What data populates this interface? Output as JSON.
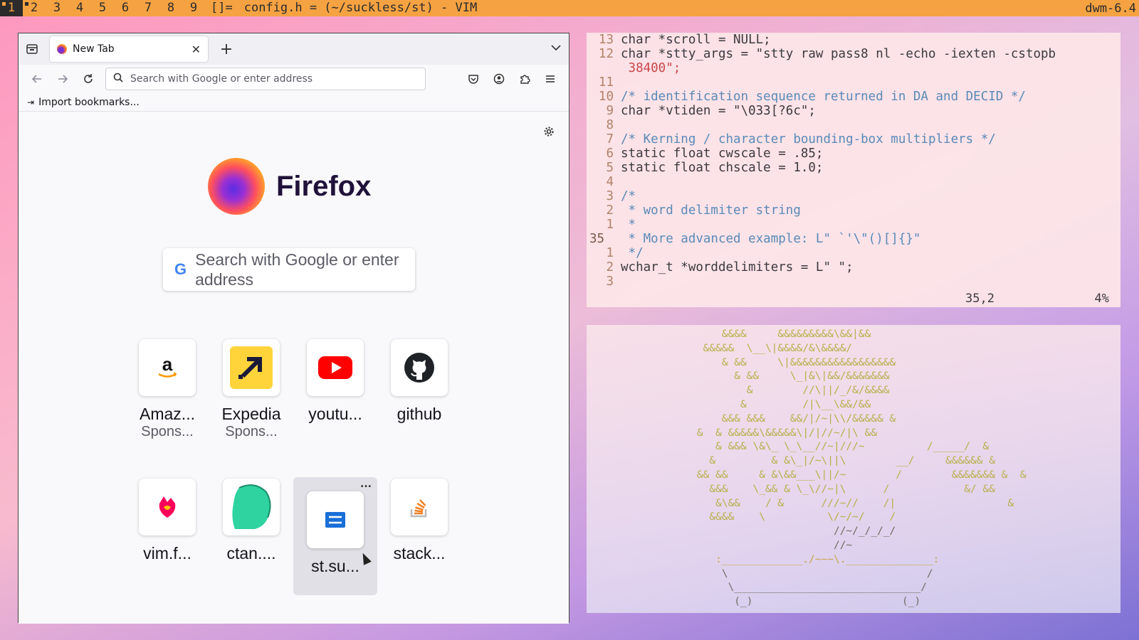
{
  "topbar": {
    "tags": [
      "1",
      "2",
      "3",
      "4",
      "5",
      "6",
      "7",
      "8",
      "9"
    ],
    "layout_symbol": "[]=",
    "window_title": "config.h = (~/suckless/st) - VIM",
    "status": "dwm-6.4"
  },
  "browser": {
    "tab_title": "New Tab",
    "tab_close": "✕",
    "new_tab": "+",
    "url_placeholder": "Search with Google or enter address",
    "import_bookmarks": "Import bookmarks...",
    "brand": "Firefox",
    "search_placeholder": "Search with Google or enter address",
    "shortcuts": [
      {
        "label": "Amaz...",
        "sub": "Spons...",
        "icon": "amazon-icon"
      },
      {
        "label": "Expedia",
        "sub": "Spons...",
        "icon": "expedia-icon"
      },
      {
        "label": "youtu...",
        "sub": "",
        "icon": "youtube-icon"
      },
      {
        "label": "github",
        "sub": "",
        "icon": "github-icon"
      },
      {
        "label": "vim.f...",
        "sub": "",
        "icon": "vim-fandom-icon"
      },
      {
        "label": "ctan....",
        "sub": "",
        "icon": "ctan-icon"
      },
      {
        "label": "st.su...",
        "sub": "",
        "icon": "st-suckless-icon"
      },
      {
        "label": "stack...",
        "sub": "",
        "icon": "stackoverflow-icon"
      }
    ],
    "tile_menu": "..."
  },
  "vim": {
    "lines": [
      {
        "n": "13",
        "text": "char *scroll = NULL;"
      },
      {
        "n": "12",
        "text": "char *stty_args = \"stty raw pass8 nl -echo -iexten -cstopb"
      },
      {
        "n": "",
        "text": " 38400\";"
      },
      {
        "n": "11",
        "text": ""
      },
      {
        "n": "10",
        "text": "/* identification sequence returned in DA and DECID */"
      },
      {
        "n": "9",
        "text": "char *vtiden = \"\\033[?6c\";"
      },
      {
        "n": "8",
        "text": ""
      },
      {
        "n": "7",
        "text": "/* Kerning / character bounding-box multipliers */"
      },
      {
        "n": "6",
        "text": "static float cwscale = .85;"
      },
      {
        "n": "5",
        "text": "static float chscale = 1.0;"
      },
      {
        "n": "4",
        "text": ""
      },
      {
        "n": "3",
        "text": "/*"
      },
      {
        "n": "2",
        "text": " * word delimiter string"
      },
      {
        "n": "1",
        "text": " *"
      },
      {
        "n": "35",
        "text": " * More advanced example: L\" `'\\\"()[]{}\""
      },
      {
        "n": "1",
        "text": " */"
      },
      {
        "n": "2",
        "text": "wchar_t *worddelimiters = L\" \";"
      },
      {
        "n": "3",
        "text": ""
      }
    ],
    "status_pos": "35,2",
    "status_pct": "4%"
  },
  "ascii_art": [
    "        &&&&     &&&&&&&&&\\&&|&&",
    "     &&&&&  \\__\\|&&&&/&\\&&&&/",
    "        & &&     \\|&&&&&&&&&&&&&&&&&",
    "          & &&     \\_|&\\|&&/&&&&&&&",
    "            &        //\\||/_/&/&&&&",
    "           &         /|\\__\\&&/&&",
    "        &&& &&&    &&/|/~|\\\\/&&&&& &",
    "    &  & &&&&&\\&&&&&\\|/|//~/|\\ &&",
    "       & &&& \\&\\_ \\_\\__//~|///~          /_____/  &",
    "      &         & &\\_|/~\\||\\        __/     &&&&&& &",
    "    && &&     & &\\&&___\\||/~        /        &&&&&&& &  &",
    "      &&&    \\_&& & \\_\\//~|\\      /            &/ &&",
    "       &\\&&    / &      ///~//    /|                  &",
    "      &&&&    \\          \\/~/~/    /",
    "                          //~/_/_/_/",
    "                          //~",
    "       :_____________./~~~\\.______________:",
    "        \\                                /",
    "         \\______________________________/",
    "          (_)                        (_)"
  ]
}
